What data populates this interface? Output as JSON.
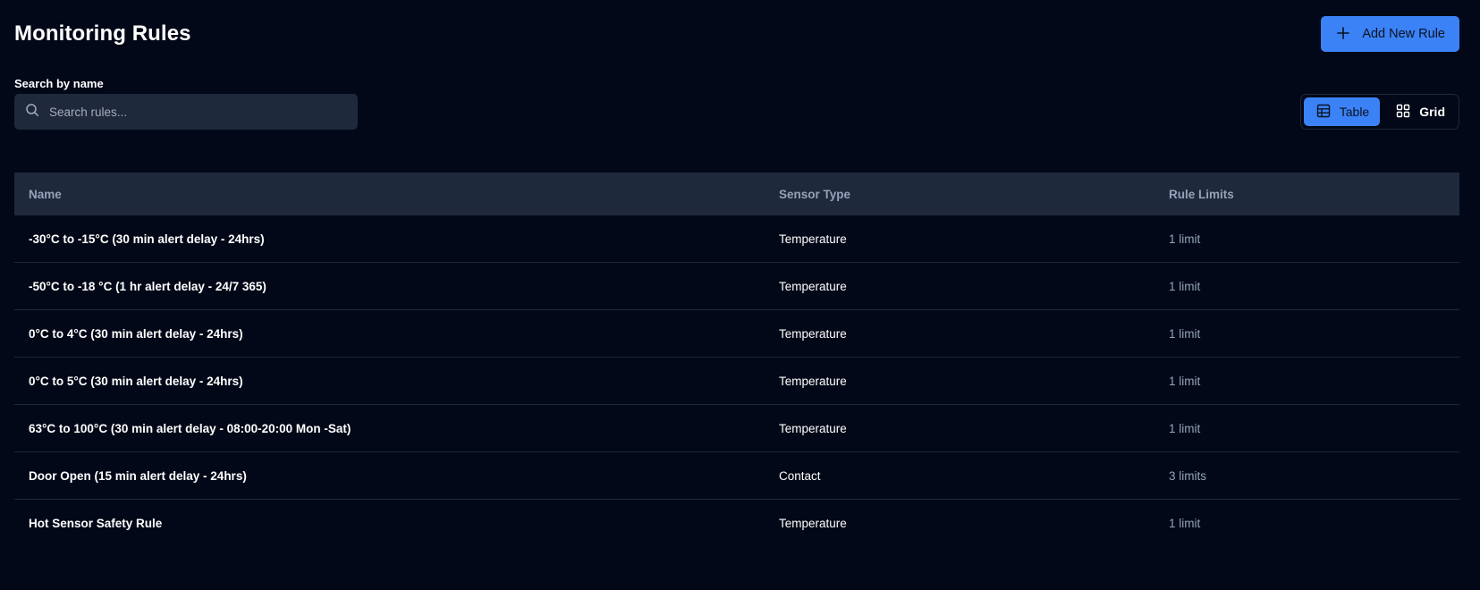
{
  "header": {
    "title": "Monitoring Rules",
    "add_button_label": "Add New Rule"
  },
  "search": {
    "label": "Search by name",
    "placeholder": "Search rules...",
    "value": ""
  },
  "view_toggle": {
    "table_label": "Table",
    "grid_label": "Grid",
    "active": "Table"
  },
  "table": {
    "columns": [
      "Name",
      "Sensor Type",
      "Rule Limits"
    ],
    "rows": [
      {
        "name": "-30°C to -15°C (30 min alert delay - 24hrs)",
        "sensor_type": "Temperature",
        "limits": "1 limit"
      },
      {
        "name": "-50°C to -18 °C (1 hr alert delay - 24/7 365)",
        "sensor_type": "Temperature",
        "limits": "1 limit"
      },
      {
        "name": "0°C to 4°C (30 min alert delay - 24hrs)",
        "sensor_type": "Temperature",
        "limits": "1 limit"
      },
      {
        "name": "0°C to 5°C (30 min alert delay - 24hrs)",
        "sensor_type": "Temperature",
        "limits": "1 limit"
      },
      {
        "name": "63°C to 100°C (30 min alert delay - 08:00-20:00 Mon -Sat)",
        "sensor_type": "Temperature",
        "limits": "1 limit"
      },
      {
        "name": "Door Open (15 min alert delay - 24hrs)",
        "sensor_type": "Contact",
        "limits": "3 limits"
      },
      {
        "name": "Hot Sensor Safety Rule",
        "sensor_type": "Temperature",
        "limits": "1 limit"
      }
    ]
  },
  "colors": {
    "background": "#020817",
    "surface": "#1e293b",
    "accent": "#3b82f6",
    "muted_text": "#94a3b8"
  },
  "icons": {
    "add": "plus-icon",
    "search": "search-icon",
    "table_view": "table-icon",
    "grid_view": "grid-icon"
  }
}
